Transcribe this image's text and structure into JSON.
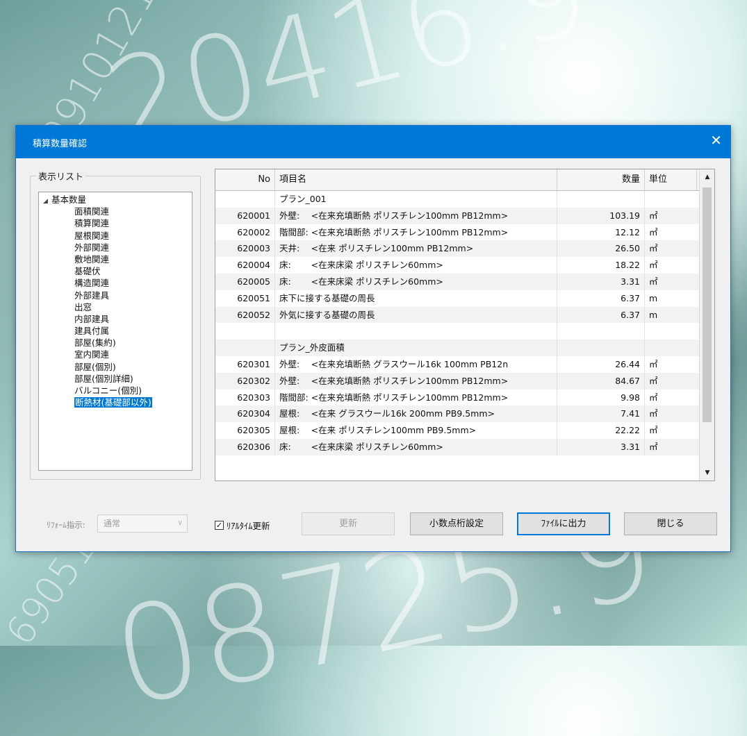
{
  "dialog": {
    "title": "積算数量確認",
    "close_symbol": "✕"
  },
  "display_list": {
    "legend": "表示リスト",
    "root": "基本数量",
    "items": [
      "面積関連",
      "積算関連",
      "屋根関連",
      "外部関連",
      "敷地関連",
      "基礎伏",
      "構造関連",
      "外部建具",
      "出窓",
      "内部建具",
      "建具付属",
      "部屋(集約)",
      "室内関連",
      "部屋(個別)",
      "部屋(個別詳細)",
      "バルコニー(個別)",
      "断熱材(基礎部以外)"
    ],
    "selected_index": 16
  },
  "grid": {
    "headers": {
      "no": "No",
      "name": "項目名",
      "qty": "数量",
      "unit": "単位"
    },
    "rows": [
      {
        "no": "",
        "name": "プラン_001",
        "qty": "",
        "unit": ""
      },
      {
        "no": "620001",
        "name": "外壁:　 <在来充填断熱 ポリスチレン100mm PB12mm>",
        "qty": "103.19",
        "unit": "㎡"
      },
      {
        "no": "620002",
        "name": "階間部: <在来充填断熱 ポリスチレン100mm PB12mm>",
        "qty": "12.12",
        "unit": "㎡"
      },
      {
        "no": "620003",
        "name": "天井:　 <在来 ポリスチレン100mm PB12mm>",
        "qty": "26.50",
        "unit": "㎡"
      },
      {
        "no": "620004",
        "name": "床:　　 <在来床梁 ポリスチレン60mm>",
        "qty": "18.22",
        "unit": "㎡"
      },
      {
        "no": "620005",
        "name": "床:　　 <在来床梁 ポリスチレン60mm>",
        "qty": "3.31",
        "unit": "㎡"
      },
      {
        "no": "620051",
        "name": "床下に接する基礎の周長",
        "qty": "6.37",
        "unit": "m"
      },
      {
        "no": "620052",
        "name": "外気に接する基礎の周長",
        "qty": "6.37",
        "unit": "m"
      },
      {
        "no": "",
        "name": "",
        "qty": "",
        "unit": ""
      },
      {
        "no": "",
        "name": "プラン_外皮面積",
        "qty": "",
        "unit": ""
      },
      {
        "no": "620301",
        "name": "外壁:　 <在来充填断熱 グラスウール16k 100mm PB12n",
        "qty": "26.44",
        "unit": "㎡"
      },
      {
        "no": "620302",
        "name": "外壁:　 <在来充填断熱 ポリスチレン100mm PB12mm>",
        "qty": "84.67",
        "unit": "㎡"
      },
      {
        "no": "620303",
        "name": "階間部: <在来充填断熱 ポリスチレン100mm PB12mm>",
        "qty": "9.98",
        "unit": "㎡"
      },
      {
        "no": "620304",
        "name": "屋根:　 <在来 グラスウール16k 200mm PB9.5mm>",
        "qty": "7.41",
        "unit": "㎡"
      },
      {
        "no": "620305",
        "name": "屋根:　 <在来 ポリスチレン100mm PB9.5mm>",
        "qty": "22.22",
        "unit": "㎡"
      },
      {
        "no": "620306",
        "name": "床:　　 <在来床梁 ポリスチレン60mm>",
        "qty": "3.31",
        "unit": "㎡"
      }
    ]
  },
  "footer": {
    "reform_label": "ﾘﾌｫｰﾑ指示:",
    "reform_value": "通常",
    "realtime_label": "ﾘｱﾙﾀｲﾑ更新",
    "realtime_checked": true,
    "update_button": "更新",
    "decimal_button": "小数点桁設定",
    "file_button": "ﾌｧｲﾙに出力",
    "close_button": "閉じる"
  }
}
